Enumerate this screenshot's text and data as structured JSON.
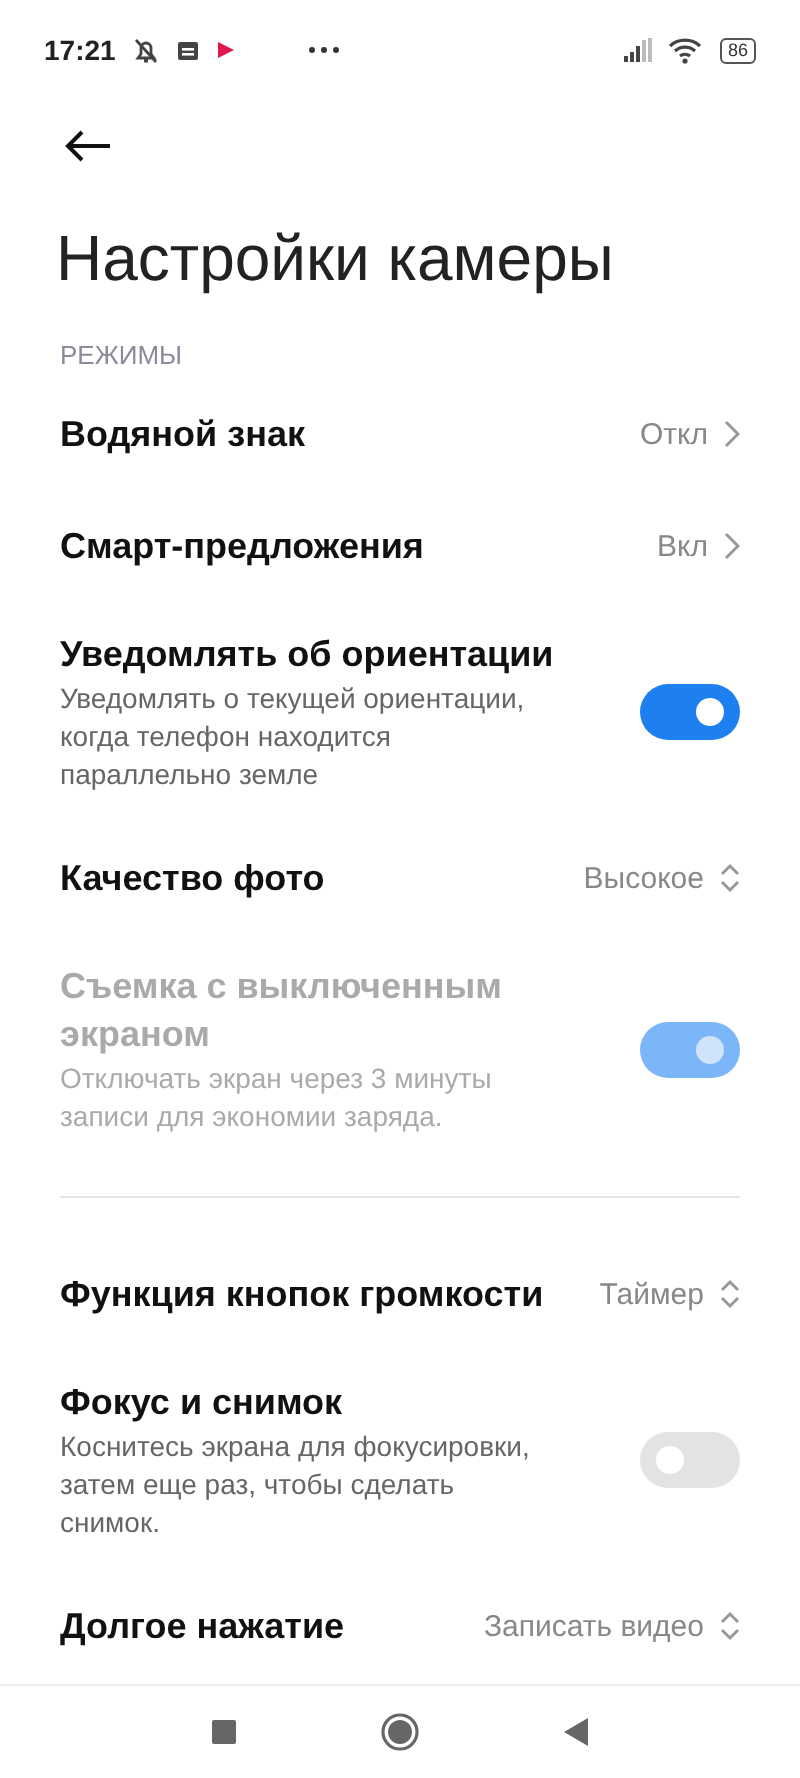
{
  "status_bar": {
    "time": "17:21",
    "battery": "86"
  },
  "header": {
    "title": "Настройки камеры"
  },
  "section": {
    "title": "РЕЖИМЫ"
  },
  "rows": [
    {
      "kind": "link",
      "title": "Водяной знак",
      "value": "Откл"
    },
    {
      "kind": "link",
      "title": "Смарт-предложения",
      "value": "Вкл"
    },
    {
      "kind": "toggle",
      "title": "Уведомлять об ориентации",
      "subtitle": "Уведомлять о текущей ориентации, когда телефон находится параллельно земле",
      "on": true,
      "disabled": false
    },
    {
      "kind": "select",
      "title": "Качество фото",
      "value": "Высокое"
    },
    {
      "kind": "toggle",
      "title": "Съемка с выключенным экраном",
      "subtitle": "Отключать экран через 3 минуты записи для экономии заряда.",
      "on": true,
      "disabled": true
    },
    {
      "kind": "divider"
    },
    {
      "kind": "select",
      "title": "Функция кнопок громкости",
      "value": "Таймер"
    },
    {
      "kind": "toggle",
      "title": "Фокус и снимок",
      "subtitle": "Коснитесь экрана для фокусировки, затем еще раз, чтобы сделать снимок.",
      "on": false,
      "disabled": false
    },
    {
      "kind": "select",
      "title": "Долгое нажатие",
      "value": "Записать видео"
    }
  ]
}
